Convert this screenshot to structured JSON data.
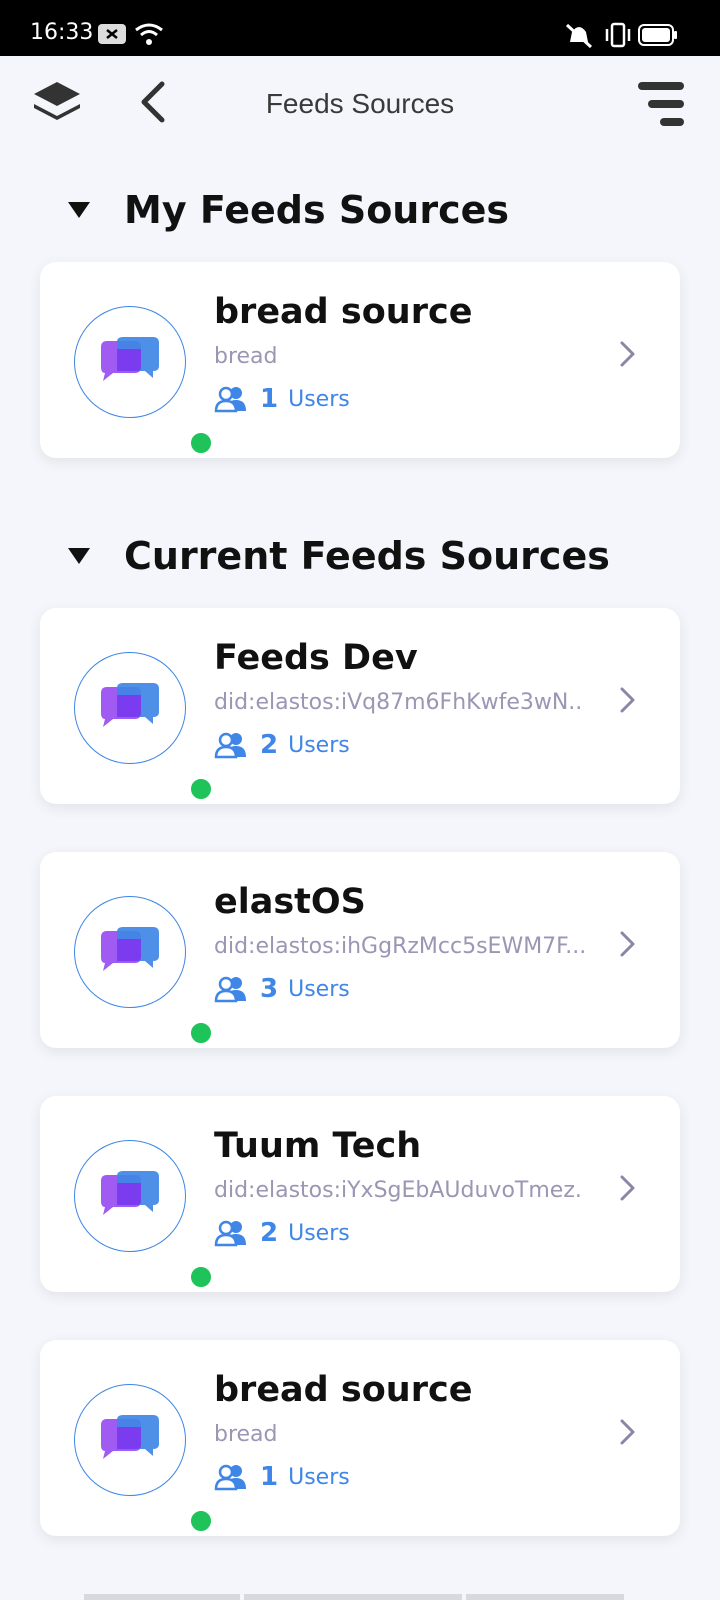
{
  "status": {
    "time": "16:33"
  },
  "header": {
    "title": "Feeds Sources"
  },
  "sections": {
    "mine": {
      "title": "My Feeds Sources"
    },
    "current": {
      "title": "Current Feeds Sources"
    }
  },
  "my_sources": [
    {
      "name": "bread source",
      "sub": "bread",
      "users": "1",
      "users_label": "Users"
    }
  ],
  "current_sources": [
    {
      "name": "Feeds Dev",
      "sub": "did:elastos:iVq87m6FhKwfe3wN...",
      "users": "2",
      "users_label": "Users"
    },
    {
      "name": "elastOS",
      "sub": "did:elastos:ihGgRzMcc5sEWM7F...",
      "users": "3",
      "users_label": "Users"
    },
    {
      "name": "Tuum Tech",
      "sub": "did:elastos:iYxSgEbAUduvoTmez...",
      "users": "2",
      "users_label": "Users"
    },
    {
      "name": "bread source",
      "sub": "bread",
      "users": "1",
      "users_label": "Users"
    }
  ],
  "colors": {
    "accent": "#3f86e6",
    "online": "#1ec35a",
    "bubble_back": "#a05cf2",
    "bubble_front": "#3f86e6"
  }
}
